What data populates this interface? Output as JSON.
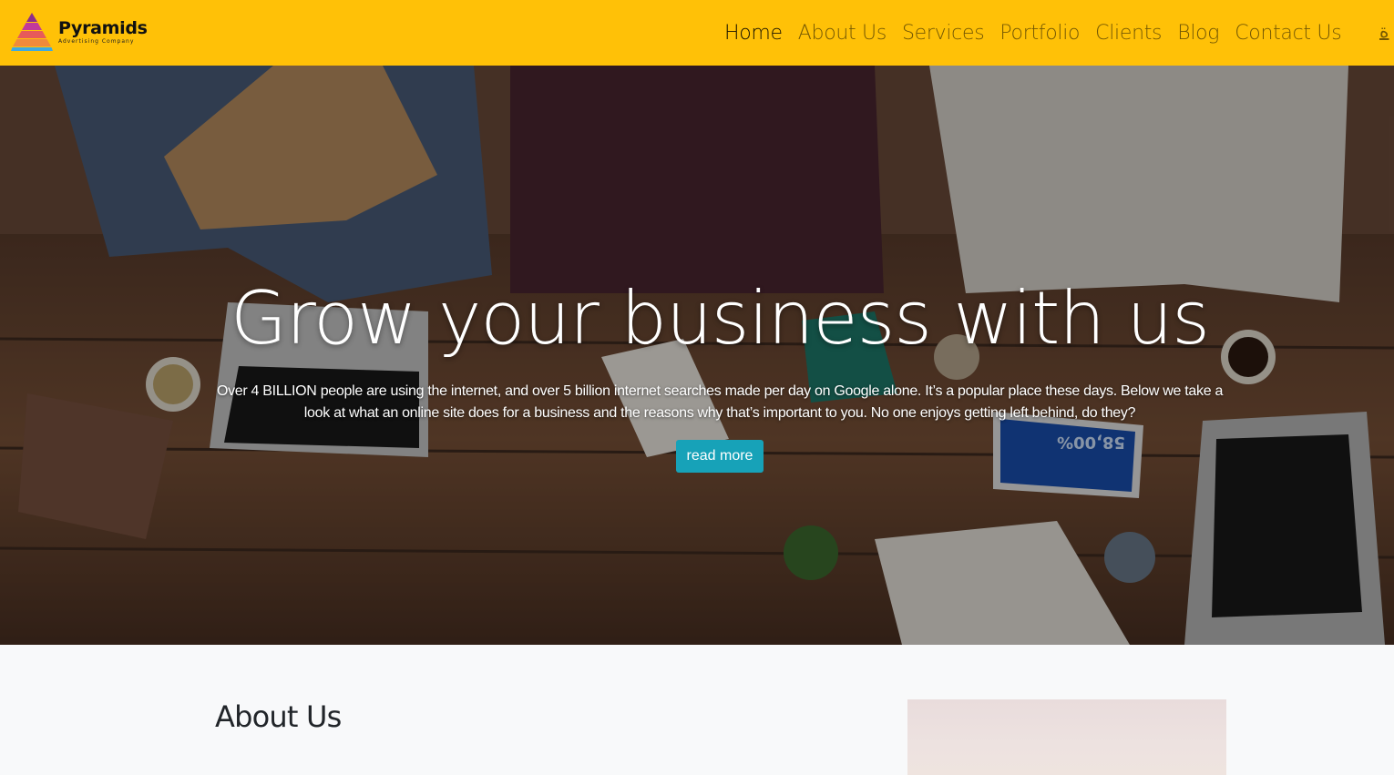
{
  "brand": {
    "name": "Pyramids",
    "tagline": "Advertising Company"
  },
  "nav": {
    "items": [
      {
        "label": "Home",
        "active": true
      },
      {
        "label": "About Us",
        "active": false
      },
      {
        "label": "Services",
        "active": false
      },
      {
        "label": "Portfolio",
        "active": false
      },
      {
        "label": "Clients",
        "active": false
      },
      {
        "label": "Blog",
        "active": false
      },
      {
        "label": "Contact Us",
        "active": false
      }
    ],
    "language_label": "ة"
  },
  "hero": {
    "title": "Grow your business with us",
    "text": "Over 4 BILLION people are using the internet, and over 5 billion internet searches made per day on Google alone. It’s a popular place these days. Below we take a look at what an online site does for a business and the reasons why that’s important to you. No one enjoys getting left behind, do they?",
    "button_label": "read more",
    "tablet_screen_text": "58,00%"
  },
  "about": {
    "title": "About Us"
  },
  "colors": {
    "navbar_bg": "#ffc107",
    "button_bg": "#17a2b8",
    "page_bg": "#f8f9fa"
  }
}
